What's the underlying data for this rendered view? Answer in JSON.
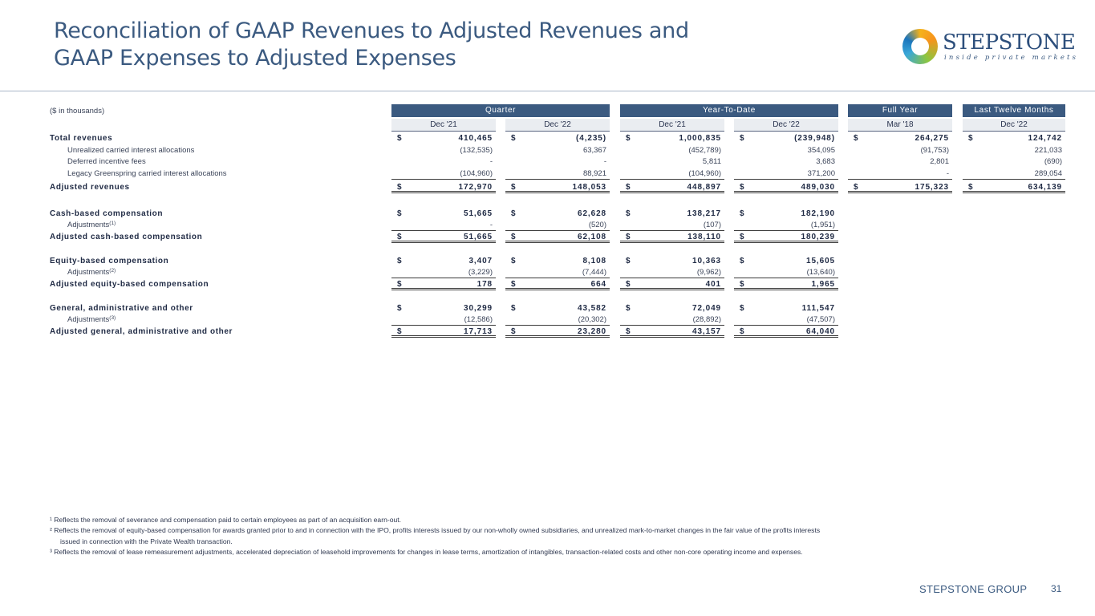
{
  "title": {
    "line1": "Reconciliation of GAAP Revenues to Adjusted Revenues and",
    "line2": "GAAP Expenses to Adjusted Expenses"
  },
  "logo": {
    "word": "STEPSTONE",
    "tagline": "inside private markets"
  },
  "table": {
    "units": "($ in thousands)",
    "groups": [
      "Quarter",
      "Year-To-Date",
      "Full Year",
      "Last Twelve Months"
    ],
    "periods": [
      "Dec '21",
      "Dec '22",
      "Dec '21",
      "Dec '22",
      "Mar '18",
      "Dec '22"
    ],
    "rows": [
      {
        "label": "Total revenues",
        "style": "bold",
        "cur": [
          "$",
          "$",
          "$",
          "$",
          "$",
          "$"
        ],
        "values": [
          "410,465",
          "(4,235)",
          "1,000,835",
          "(239,948)",
          "264,275",
          "124,742"
        ]
      },
      {
        "label": "Unrealized carried interest allocations",
        "style": "sub",
        "cur": [
          "",
          "",
          "",
          "",
          "",
          ""
        ],
        "values": [
          "(132,535)",
          "63,367",
          "(452,789)",
          "354,095",
          "(91,753)",
          "221,033"
        ]
      },
      {
        "label": "Deferred incentive fees",
        "style": "sub",
        "cur": [
          "",
          "",
          "",
          "",
          "",
          ""
        ],
        "values": [
          "-",
          "-",
          "5,811",
          "3,683",
          "2,801",
          "(690)"
        ]
      },
      {
        "label": "Legacy Greenspring carried interest allocations",
        "style": "sub",
        "cur": [
          "",
          "",
          "",
          "",
          "",
          ""
        ],
        "values": [
          "(104,960)",
          "88,921",
          "(104,960)",
          "371,200",
          "-",
          "289,054"
        ]
      },
      {
        "label": "Adjusted revenues",
        "style": "bold",
        "cur": [
          "$",
          "$",
          "$",
          "$",
          "$",
          "$"
        ],
        "values": [
          "172,970",
          "148,053",
          "448,897",
          "489,030",
          "175,323",
          "634,139"
        ]
      },
      {
        "label": "Cash-based compensation",
        "style": "bold",
        "cur": [
          "$",
          "$",
          "$",
          "$"
        ],
        "values": [
          "51,665",
          "62,628",
          "138,217",
          "182,190"
        ]
      },
      {
        "label": "Adjustments",
        "sup": "(1)",
        "style": "sub",
        "cur": [
          "",
          "",
          "",
          ""
        ],
        "values": [
          "-",
          "(520)",
          "(107)",
          "(1,951)"
        ]
      },
      {
        "label": "Adjusted cash-based compensation",
        "style": "bold",
        "cur": [
          "$",
          "$",
          "$",
          "$"
        ],
        "values": [
          "51,665",
          "62,108",
          "138,110",
          "180,239"
        ]
      },
      {
        "label": "Equity-based compensation",
        "style": "bold",
        "cur": [
          "$",
          "$",
          "$",
          "$"
        ],
        "values": [
          "3,407",
          "8,108",
          "10,363",
          "15,605"
        ]
      },
      {
        "label": "Adjustments",
        "sup": "(2)",
        "style": "sub",
        "cur": [
          "",
          "",
          "",
          ""
        ],
        "values": [
          "(3,229)",
          "(7,444)",
          "(9,962)",
          "(13,640)"
        ]
      },
      {
        "label": "Adjusted equity-based compensation",
        "style": "bold",
        "cur": [
          "$",
          "$",
          "$",
          "$"
        ],
        "values": [
          "178",
          "664",
          "401",
          "1,965"
        ]
      },
      {
        "label": "General, administrative and other",
        "style": "bold",
        "cur": [
          "$",
          "$",
          "$",
          "$"
        ],
        "values": [
          "30,299",
          "43,582",
          "72,049",
          "111,547"
        ]
      },
      {
        "label": "Adjustments",
        "sup": "(3)",
        "style": "sub",
        "cur": [
          "",
          "",
          "",
          ""
        ],
        "values": [
          "(12,586)",
          "(20,302)",
          "(28,892)",
          "(47,507)"
        ]
      },
      {
        "label": "Adjusted general, administrative and other",
        "style": "bold",
        "cur": [
          "$",
          "$",
          "$",
          "$"
        ],
        "values": [
          "17,713",
          "23,280",
          "43,157",
          "64,040"
        ]
      }
    ]
  },
  "footnotes": {
    "fn1": "¹ Reflects the removal of severance and compensation paid to certain employees as part of an acquisition earn-out.",
    "fn2a": "² Reflects the removal of equity-based compensation for awards granted prior to and in connection with the IPO, profits interests issued by our non-wholly owned subsidiaries, and unrealized mark-to-market changes in the fair value of the profits interests",
    "fn2b": "issued in connection with the Private Wealth transaction.",
    "fn3": "³ Reflects the removal of lease remeasurement adjustments, accelerated depreciation of leasehold improvements for changes in lease terms, amortization of intangibles, transaction-related costs and other non-core operating income and expenses."
  },
  "footer": {
    "brand": "STEPSTONE GROUP",
    "page": "31"
  }
}
